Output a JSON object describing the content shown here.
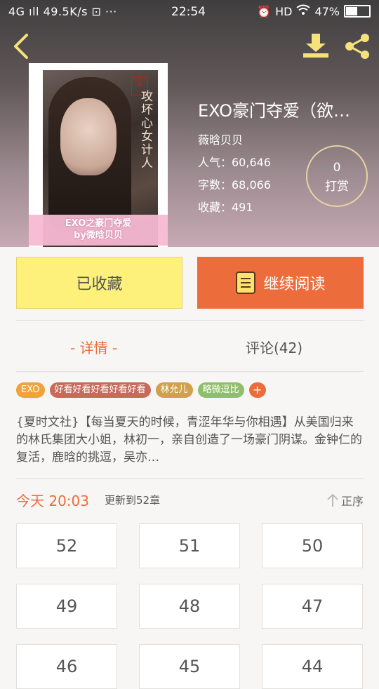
{
  "status_bar": {
    "left": "4G ıll 49.5K/s ⊡ ···",
    "time": "22:54",
    "hd": "HD",
    "battery": "47%"
  },
  "nav": {
    "back_icon": "chevron-left-icon",
    "download_icon": "download-icon",
    "share_icon": "share-icon"
  },
  "cover": {
    "title_text": "攻坏心女计人",
    "seal": "文轩小说",
    "banner_line1": "EXO之豪门夺爱",
    "banner_line2": "by微晗贝贝"
  },
  "book": {
    "title": "EXO豪门夺爱（欲…",
    "author": "薇晗贝贝",
    "popularity": "人气：60,646",
    "word_count": "字数：68,066",
    "favorites": "收藏：491"
  },
  "reward": {
    "count": "0",
    "label": "打赏"
  },
  "actions": {
    "favorite": "已收藏",
    "read": "继续阅读"
  },
  "tabs": {
    "detail": "- 详情 -",
    "comments": "评论(42)"
  },
  "tags": [
    {
      "label": "EXO",
      "color": "#f0a23b"
    },
    {
      "label": "好看好看好看好看好看",
      "color": "#c86a5a"
    },
    {
      "label": "林允儿",
      "color": "#d1a04a"
    },
    {
      "label": "略微逗比",
      "color": "#8fbf6a"
    },
    {
      "label": "+",
      "color": "#ec6c3b"
    }
  ],
  "synopsis": "{夏时文社}【每当夏天的时候，青涩年华与你相遇】从美国归来的林氏集团大小姐，林初一，亲自创造了一场豪门阴谋。金钟仁的复活，鹿晗的挑逗，吴亦…",
  "update": {
    "today": "今天 20:03",
    "text": "更新到52章",
    "order": "正序"
  },
  "chapters": [
    "52",
    "51",
    "50",
    "49",
    "48",
    "47",
    "46",
    "45",
    "44"
  ],
  "colors": {
    "accent": "#ec6c3b",
    "fav_bg": "#fdf17c"
  }
}
